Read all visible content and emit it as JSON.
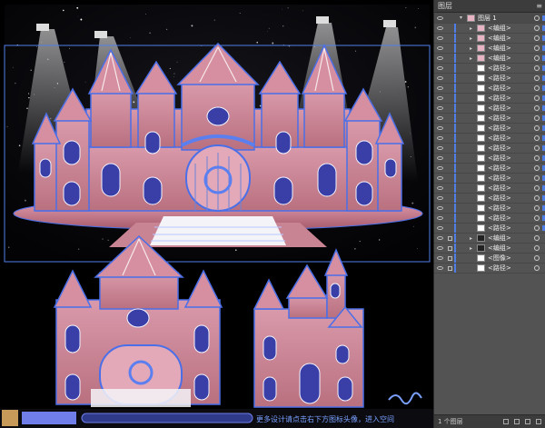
{
  "layers_panel": {
    "title": "图层",
    "menu_icon": "panel-menu-icon",
    "top_layer": {
      "label": "图层 1"
    },
    "rows": [
      {
        "label": "<编组>",
        "thumb": "pink",
        "expand": true
      },
      {
        "label": "<编组>",
        "thumb": "pink",
        "expand": true
      },
      {
        "label": "<编组>",
        "thumb": "pink",
        "expand": true
      },
      {
        "label": "<编组>",
        "thumb": "pink",
        "expand": true
      },
      {
        "label": "<路径>",
        "thumb": "white",
        "expand": false
      },
      {
        "label": "<路径>",
        "thumb": "white",
        "expand": false
      },
      {
        "label": "<路径>",
        "thumb": "white",
        "expand": false
      },
      {
        "label": "<路径>",
        "thumb": "white",
        "expand": false
      },
      {
        "label": "<路径>",
        "thumb": "white",
        "expand": false
      },
      {
        "label": "<路径>",
        "thumb": "white",
        "expand": false
      },
      {
        "label": "<路径>",
        "thumb": "white",
        "expand": false
      },
      {
        "label": "<路径>",
        "thumb": "white",
        "expand": false
      },
      {
        "label": "<路径>",
        "thumb": "white",
        "expand": false
      },
      {
        "label": "<路径>",
        "thumb": "white",
        "expand": false
      },
      {
        "label": "<路径>",
        "thumb": "white",
        "expand": false
      },
      {
        "label": "<路径>",
        "thumb": "white",
        "expand": false
      },
      {
        "label": "<路径>",
        "thumb": "white",
        "expand": false
      },
      {
        "label": "<路径>",
        "thumb": "white",
        "expand": false
      },
      {
        "label": "<路径>",
        "thumb": "white",
        "expand": false
      },
      {
        "label": "<路径>",
        "thumb": "white",
        "expand": false
      },
      {
        "label": "<路径>",
        "thumb": "white",
        "expand": false
      },
      {
        "label": "<编组>",
        "thumb": "dark",
        "expand": true,
        "locked": true
      },
      {
        "label": "<编组>",
        "thumb": "dark",
        "expand": true,
        "locked": true
      },
      {
        "label": "<图像>",
        "thumb": "white",
        "expand": false,
        "locked": true
      },
      {
        "label": "<路径>",
        "thumb": "white",
        "expand": false,
        "locked": true
      }
    ],
    "footer": {
      "count": "1 个图层"
    }
  },
  "canvas": {
    "caption": "更多设计请点击右下方图标头像，进入空间"
  },
  "colors": {
    "castle_pink": "#d28a9c",
    "castle_blue": "#4a6fe8",
    "night_sky": "#050508",
    "selection": "#4f7fe6"
  }
}
